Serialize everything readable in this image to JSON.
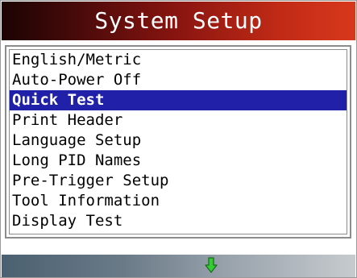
{
  "title": "System Setup",
  "menu": {
    "items": [
      {
        "label": "English/Metric"
      },
      {
        "label": "Auto-Power Off"
      },
      {
        "label": "Quick Test"
      },
      {
        "label": "Print Header"
      },
      {
        "label": "Language Setup"
      },
      {
        "label": "Long PID Names"
      },
      {
        "label": "Pre-Trigger Setup"
      },
      {
        "label": "Tool Information"
      },
      {
        "label": "Display Test"
      }
    ],
    "selected_index": 2
  },
  "footer": {
    "indicator_icon": "down-arrow-icon",
    "indicator_color": "#33cc33"
  },
  "colors": {
    "title_bar_accent": "#c02a16",
    "selection": "#2020a8"
  }
}
